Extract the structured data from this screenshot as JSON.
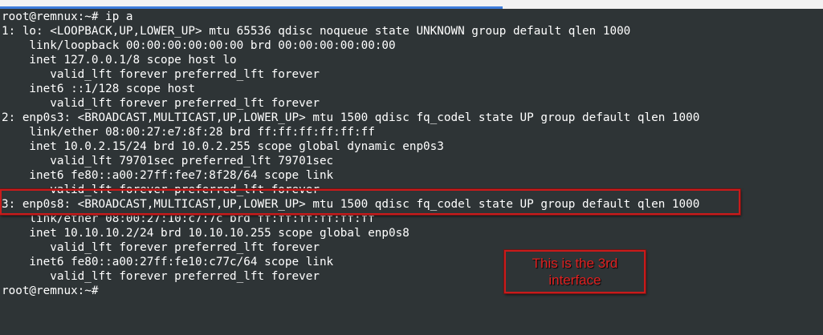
{
  "terminal": {
    "lines": [
      "root@remnux:~# ip a",
      "1: lo: <LOOPBACK,UP,LOWER_UP> mtu 65536 qdisc noqueue state UNKNOWN group default qlen 1000",
      "    link/loopback 00:00:00:00:00:00 brd 00:00:00:00:00:00",
      "    inet 127.0.0.1/8 scope host lo",
      "       valid_lft forever preferred_lft forever",
      "    inet6 ::1/128 scope host",
      "       valid_lft forever preferred_lft forever",
      "2: enp0s3: <BROADCAST,MULTICAST,UP,LOWER_UP> mtu 1500 qdisc fq_codel state UP group default qlen 1000",
      "    link/ether 08:00:27:e7:8f:28 brd ff:ff:ff:ff:ff:ff",
      "    inet 10.0.2.15/24 brd 10.0.2.255 scope global dynamic enp0s3",
      "       valid_lft 79701sec preferred_lft 79701sec",
      "    inet6 fe80::a00:27ff:fee7:8f28/64 scope link",
      "       valid_lft forever preferred_lft forever",
      "3: enp0s8: <BROADCAST,MULTICAST,UP,LOWER_UP> mtu 1500 qdisc fq_codel state UP group default qlen 1000",
      "    link/ether 08:00:27:10:c7:7c brd ff:ff:ff:ff:ff:ff",
      "    inet 10.10.10.2/24 brd 10.10.10.255 scope global enp0s8",
      "       valid_lft forever preferred_lft forever",
      "    inet6 fe80::a00:27ff:fe10:c77c/64 scope link",
      "       valid_lft forever preferred_lft forever",
      "root@remnux:~#"
    ]
  },
  "annotation": {
    "callout_text": "This is the 3rd interface",
    "color": "#c81b1b"
  },
  "colors": {
    "background": "#2e3436",
    "text": "#ffffff",
    "top_strip": "#f2f2f2",
    "top_strip_accent": "#3d7bd9"
  }
}
